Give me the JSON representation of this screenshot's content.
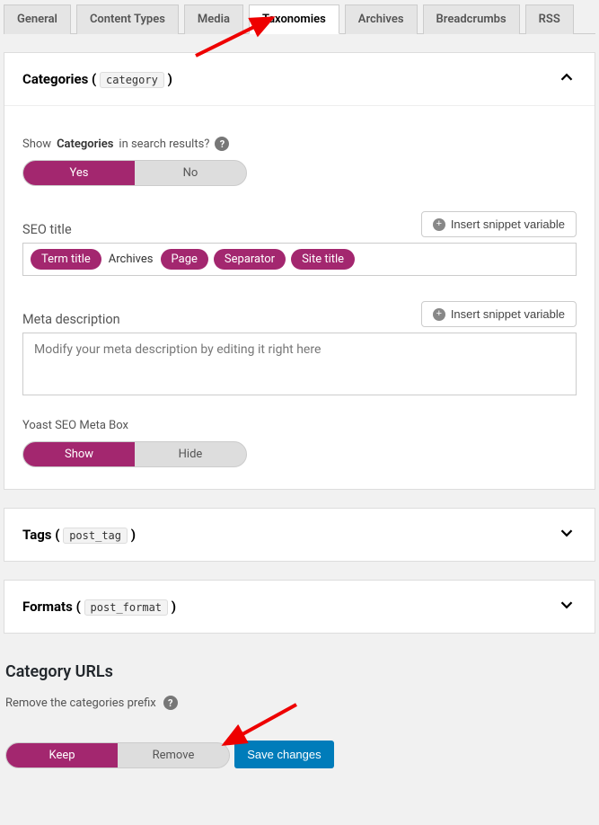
{
  "tabs": {
    "general": "General",
    "content_types": "Content Types",
    "media": "Media",
    "taxonomies": "Taxonomies",
    "archives": "Archives",
    "breadcrumbs": "Breadcrumbs",
    "rss": "RSS"
  },
  "categories": {
    "title_prefix": "Categories (",
    "title_code": "category",
    "title_suffix": ")",
    "show_label_pre": "Show",
    "show_label_bold": "Categories",
    "show_label_post": "in search results?",
    "toggle_yes": "Yes",
    "toggle_no": "No",
    "seo_title_label": "SEO title",
    "insert_snippet_label": "Insert snippet variable",
    "snippet_vars": {
      "term_title": "Term title",
      "archives_plain": "Archives",
      "page": "Page",
      "separator": "Separator",
      "site_title": "Site title"
    },
    "meta_label": "Meta description",
    "meta_placeholder": "Modify your meta description by editing it right here",
    "metabox_label": "Yoast SEO Meta Box",
    "metabox_show": "Show",
    "metabox_hide": "Hide"
  },
  "tags": {
    "title_prefix": "Tags (",
    "title_code": "post_tag",
    "title_suffix": ")"
  },
  "formats": {
    "title_prefix": "Formats (",
    "title_code": "post_format",
    "title_suffix": ")"
  },
  "category_urls": {
    "heading": "Category URLs",
    "prefix_label": "Remove the categories prefix",
    "keep": "Keep",
    "remove": "Remove"
  },
  "save_label": "Save changes"
}
